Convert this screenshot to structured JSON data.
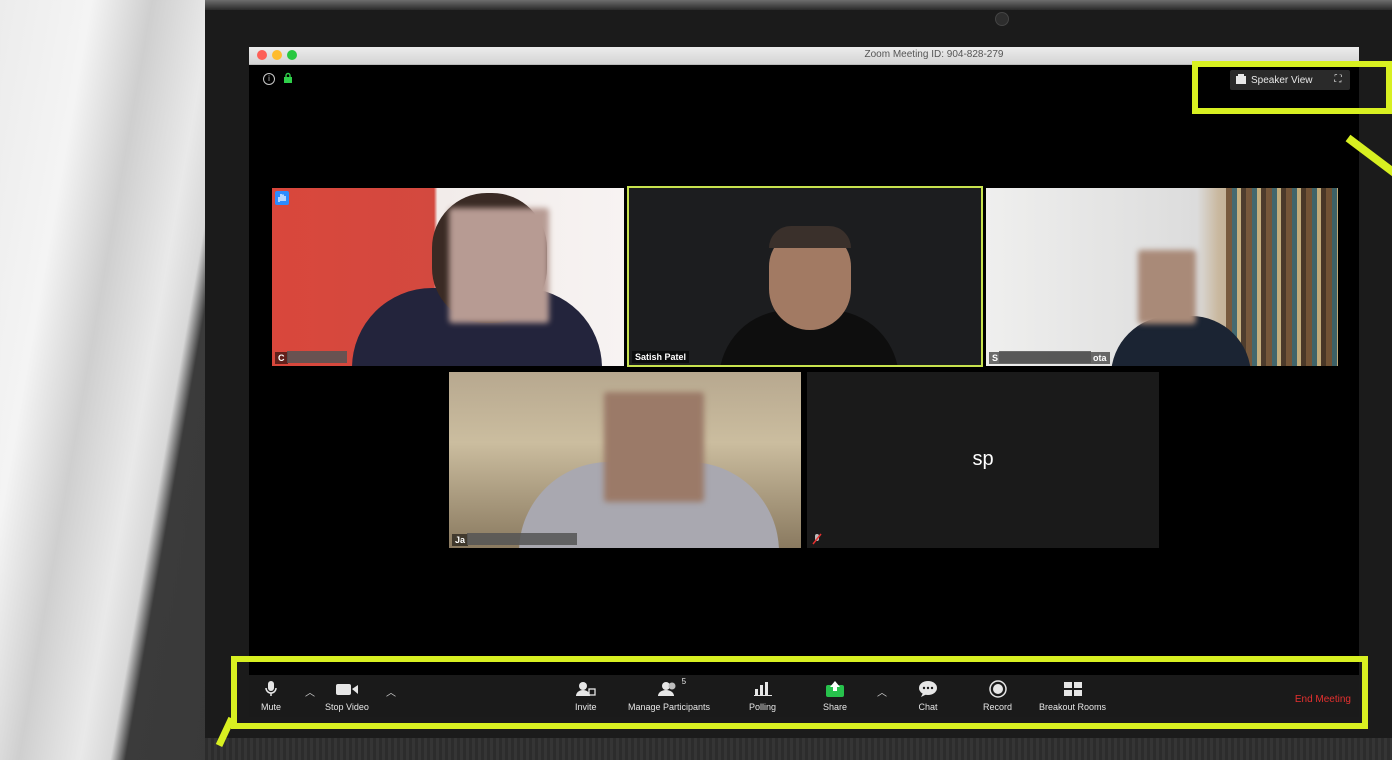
{
  "window": {
    "title": "Zoom Meeting ID: 904-828-279"
  },
  "view_controls": {
    "speaker_view_label": "Speaker View",
    "speaker_view_icon": "speaker-view-icon",
    "fullscreen_icon": "fullscreen-icon"
  },
  "tiles": [
    {
      "name": "C",
      "raised_hand": true
    },
    {
      "name": "Satish Patel",
      "active_speaker": true
    },
    {
      "name_start": "S",
      "name_end": "ota"
    },
    {
      "name": "Ja"
    },
    {
      "initials": "sp",
      "muted": true
    }
  ],
  "toolbar": {
    "mute_label": "Mute",
    "stop_video_label": "Stop Video",
    "invite_label": "Invite",
    "manage_participants_label": "Manage Participants",
    "participants_count": "5",
    "polling_label": "Polling",
    "share_label": "Share",
    "chat_label": "Chat",
    "record_label": "Record",
    "breakout_rooms_label": "Breakout Rooms",
    "end_meeting_label": "End Meeting"
  },
  "colors": {
    "highlight": "#d8f021",
    "active_speaker_border": "#c8e34e",
    "share_green": "#27c24c",
    "end_meeting_red": "#e5302f"
  }
}
